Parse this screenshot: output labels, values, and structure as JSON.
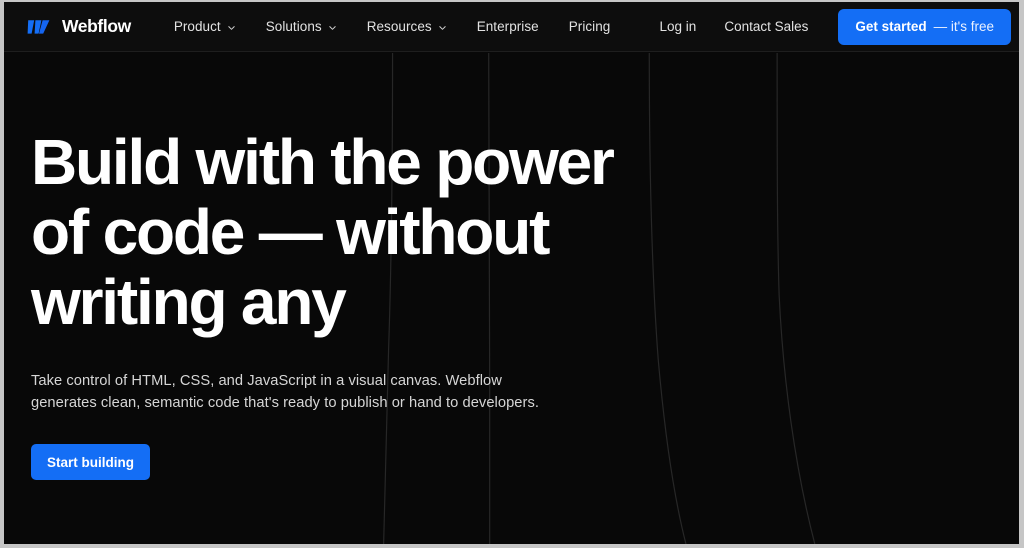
{
  "site": {
    "brand": "Webflow",
    "logo_icon": "webflow-w-logo-icon",
    "accent_color": "#146ef5",
    "background_color": "#080808",
    "nav_background_color": "#0d0d0d"
  },
  "nav": {
    "primary_items": [
      {
        "label": "Product",
        "has_dropdown": true,
        "caret_icon": "chevron-down-icon"
      },
      {
        "label": "Solutions",
        "has_dropdown": true,
        "caret_icon": "chevron-down-icon"
      },
      {
        "label": "Resources",
        "has_dropdown": true,
        "caret_icon": "chevron-down-icon"
      },
      {
        "label": "Enterprise",
        "has_dropdown": false,
        "caret_icon": ""
      },
      {
        "label": "Pricing",
        "has_dropdown": false,
        "caret_icon": ""
      }
    ],
    "login_label": "Log in",
    "contact_label": "Contact Sales",
    "cta": {
      "bold_label": "Get started",
      "regular_label": "— it's free"
    }
  },
  "hero": {
    "headline": "Build with the power of code — without writing any",
    "subtext": "Take control of HTML, CSS, and JavaScript in a visual canvas. Webflow generates clean, semantic code that's ready to publish or hand to developers.",
    "cta_label": "Start building"
  },
  "decoration": {
    "line_color": "#2a2a2a",
    "description": "four faint curved vertical lines in hero background"
  }
}
